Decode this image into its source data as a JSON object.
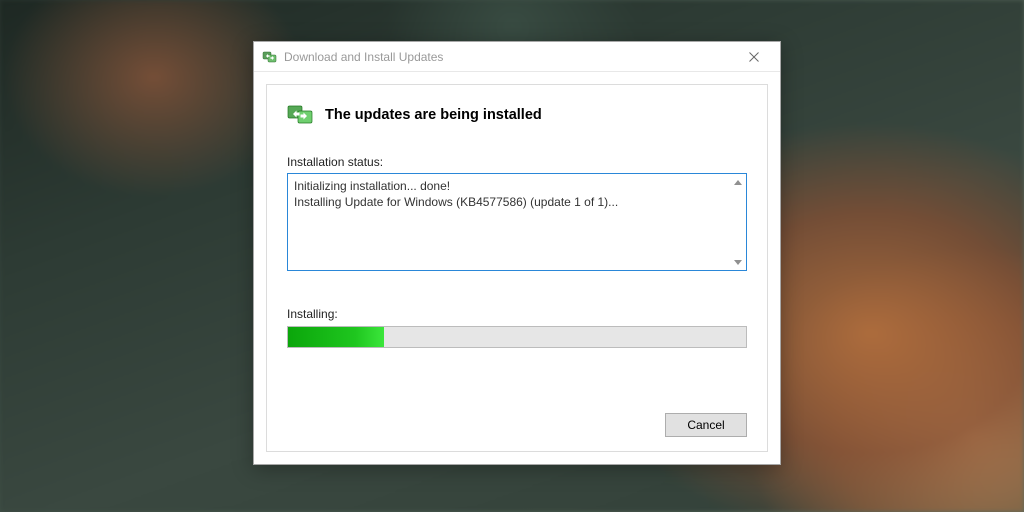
{
  "window": {
    "title": "Download and Install Updates",
    "close_tooltip": "Close"
  },
  "heading": "The updates are being installed",
  "status": {
    "label": "Installation status:",
    "line1": "Initializing installation... done!",
    "line2": "Installing Update for Windows (KB4577586) (update 1 of 1)..."
  },
  "progress": {
    "label": "Installing:",
    "percent": 21
  },
  "buttons": {
    "cancel": "Cancel"
  },
  "icons": {
    "update": "update-icon",
    "close": "close-icon"
  }
}
